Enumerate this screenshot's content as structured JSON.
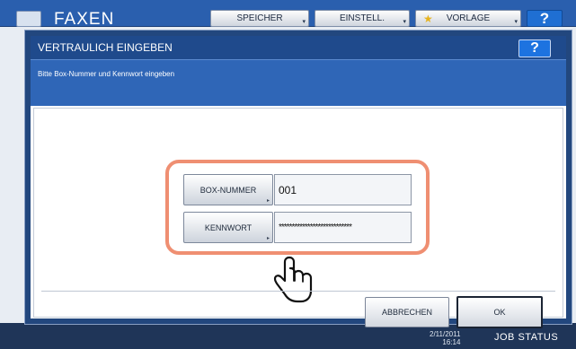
{
  "app": {
    "title": "FAXEN",
    "toolbar": {
      "speicher": "SPEICHER",
      "einstell": "EINSTELL.",
      "vorlage": "VORLAGE",
      "help": "?"
    }
  },
  "dialog": {
    "title": "VERTRAULICH EINGEBEN",
    "help": "?",
    "message": "Bitte Box-Nummer und Kennwort eingeben",
    "box_number": {
      "label": "BOX-NUMMER",
      "value": "001"
    },
    "password": {
      "label": "KENNWORT",
      "value": "****************************"
    },
    "buttons": {
      "cancel": "ABBRECHEN",
      "ok": "OK"
    }
  },
  "statusbar": {
    "date": "2/11/2011",
    "time": "16:14",
    "job_status": "JOB STATUS"
  },
  "colors": {
    "title_bar": "#1f4a8c",
    "message_bar": "#2f66b7",
    "highlight": "#ef8f72",
    "help_button": "#1d73e0"
  },
  "icons": [
    "fax-icon",
    "star-icon",
    "hand-pointer-icon"
  ]
}
